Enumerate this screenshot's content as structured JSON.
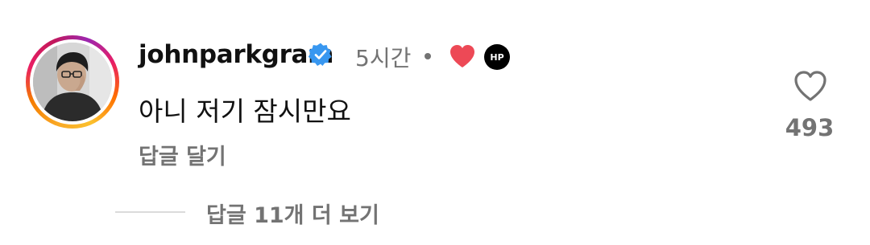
{
  "comment": {
    "username": "johnparkgram",
    "timestamp": "5시간",
    "text": "아니 저기 잠시만요",
    "reply_label": "답글 달기",
    "like_count": "493",
    "view_replies_label": "답글 11개 더 보기",
    "creator_badge": "HP",
    "liked_by_creator": true,
    "verified": true
  },
  "colors": {
    "liked_heart": "#ed4956",
    "verified_badge": "#3897f0",
    "secondary_text": "#737373"
  }
}
